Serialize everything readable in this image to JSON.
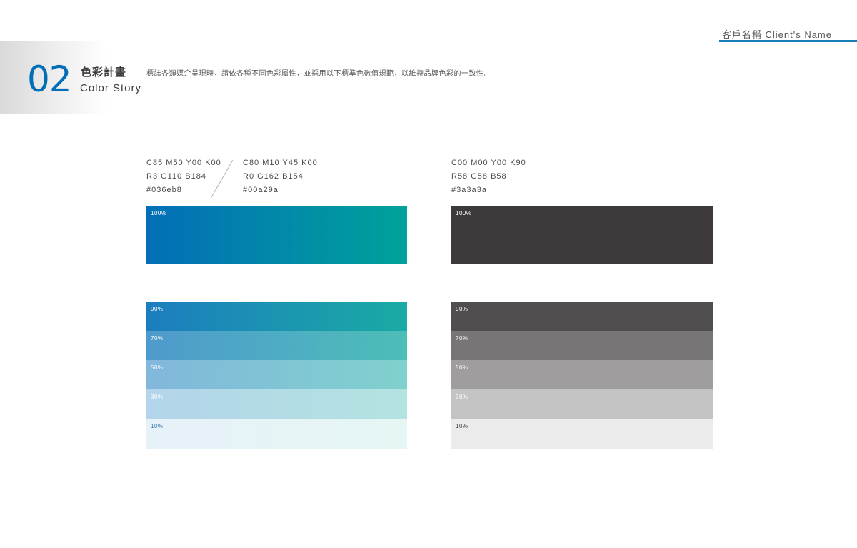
{
  "header": {
    "client_name": "客戶名稱   Client's Name"
  },
  "section": {
    "number": "02",
    "title_zh": "色彩計畫",
    "title_en": "Color Story",
    "description": "標誌各類媒介呈現時，請依各種不同色彩屬性，並採用以下標準色數值規範，以維持品牌色彩的一致性。"
  },
  "colors": {
    "blue": {
      "cmyk": "C85 M50 Y00 K00",
      "rgb": "R3 G110 B184",
      "hex": "#036eb8"
    },
    "teal": {
      "cmyk": "C80 M10 Y45 K00",
      "rgb": "R0 G162 B154",
      "hex": "#00a29a"
    },
    "grey": {
      "cmyk": "C00 M00 Y00 K90",
      "rgb": "R58 G58 B58",
      "hex": "#3a3a3a"
    },
    "grey_swatch": "#3e3a3b"
  },
  "tints": {
    "full": "100%",
    "levels": [
      "90%",
      "70%",
      "50%",
      "30%",
      "10%"
    ],
    "level_fractions": [
      0.9,
      0.7,
      0.5,
      0.3,
      0.1
    ]
  }
}
